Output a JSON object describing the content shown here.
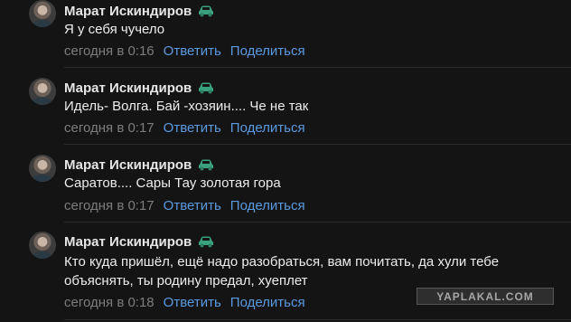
{
  "colors": {
    "background": "#141414",
    "author": "#e6e6e6",
    "text": "#ededed",
    "meta": "#7d7d7d",
    "link": "#5a9ae0",
    "car_badge": "#3aa17e"
  },
  "icons": {
    "badge": "car-icon"
  },
  "comments": [
    {
      "author": "Марат Искиндиров",
      "text": "Я у себя чучело",
      "time": "сегодня в 0:16",
      "reply": "Ответить",
      "share": "Поделиться"
    },
    {
      "author": "Марат Искиндиров",
      "text": "Идель- Волга. Бай -хозяин.... Че не так",
      "time": "сегодня в 0:17",
      "reply": "Ответить",
      "share": "Поделиться"
    },
    {
      "author": "Марат Искиндиров",
      "text": "Саратов.... Сары Тау золотая гора",
      "time": "сегодня в 0:17",
      "reply": "Ответить",
      "share": "Поделиться"
    },
    {
      "author": "Марат Искиндиров",
      "text": "Кто куда пришёл, ещё надо разобраться, вам почитать, да хули тебе объяснять, ты родину предал, хуеплет",
      "time": "сегодня в 0:18",
      "reply": "Ответить",
      "share": "Поделиться"
    }
  ],
  "watermark": "YAPLAKAL.COM"
}
